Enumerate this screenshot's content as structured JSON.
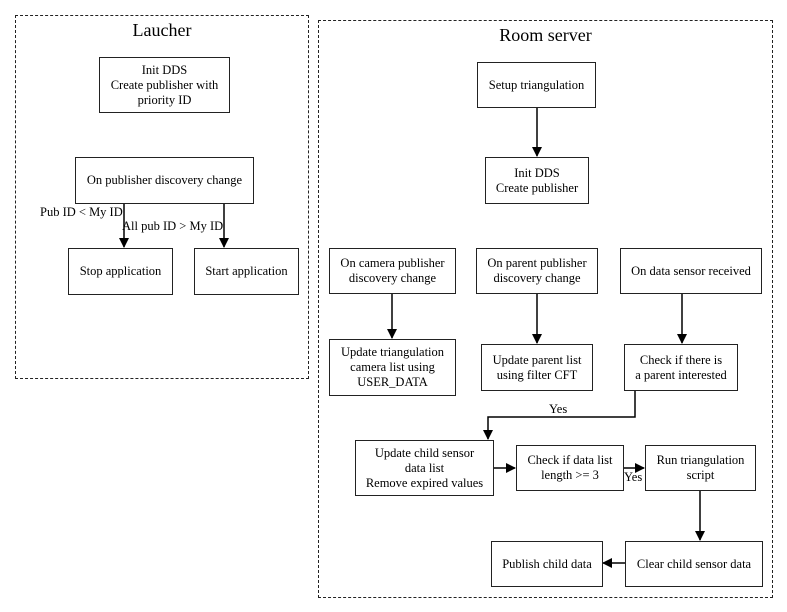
{
  "clusters": {
    "launcher": {
      "title": "Laucher",
      "nodes": {
        "init_dds": "Init DDS\nCreate publisher with\npriority ID",
        "discovery": "On publisher discovery change",
        "stop": "Stop application",
        "start": "Start application"
      },
      "edge_labels": {
        "stop": "Pub ID < My ID",
        "start": "All pub ID > My ID"
      }
    },
    "room_server": {
      "title": "Room server",
      "nodes": {
        "setup": "Setup triangulation",
        "init_dds": "Init DDS\nCreate publisher",
        "camera_discovery": "On camera publisher\ndiscovery change",
        "parent_discovery": "On parent publisher\ndiscovery change",
        "data_sensor": "On data sensor received",
        "update_tri": "Update triangulation\ncamera list using\nUSER_DATA",
        "update_parent": "Update parent list\nusing filter CFT",
        "check_parent": "Check if there is\na parent interested",
        "update_child": "Update child sensor\ndata list\nRemove expired values",
        "check_length": "Check if data list\nlength >= 3",
        "run_tri": "Run triangulation\nscript",
        "clear_child": "Clear child sensor data",
        "publish_child": "Publish child data"
      },
      "edge_labels": {
        "parent_yes": "Yes",
        "length_yes": "Yes"
      }
    }
  }
}
